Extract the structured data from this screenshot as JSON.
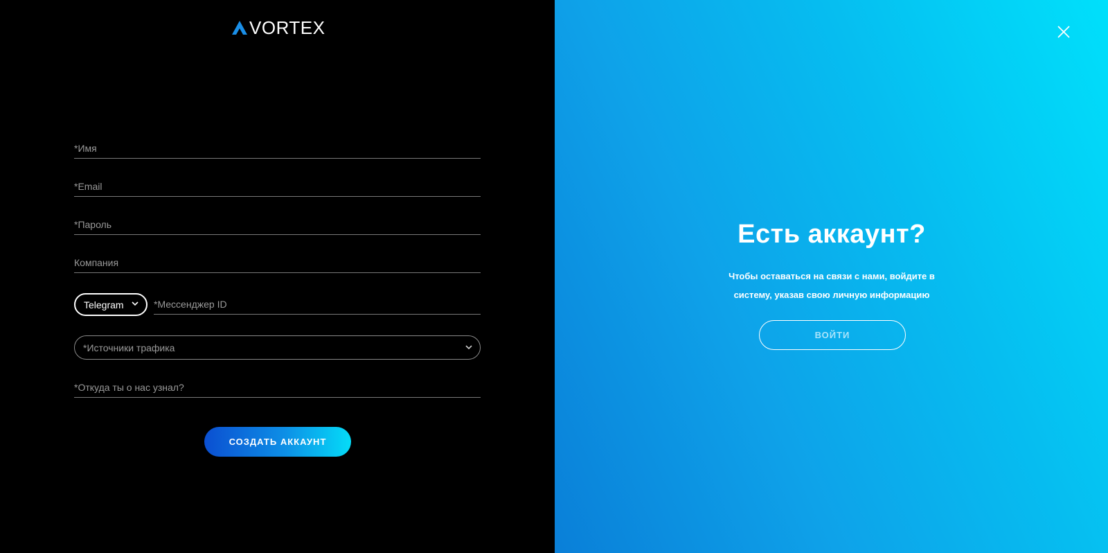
{
  "brand": {
    "name": "VORTEX",
    "accent": "#1a8fe8"
  },
  "form": {
    "name_placeholder": "*Имя",
    "email_placeholder": "*Email",
    "password_placeholder": "*Пароль",
    "company_placeholder": "Компания",
    "messenger_selected": "Telegram",
    "messenger_id_placeholder": "*Мессенджер ID",
    "traffic_sources_placeholder": "*Источники трафика",
    "referral_placeholder": "*Откуда ты о нас узнал?",
    "submit_label": "СОЗДАТЬ АККАУНТ"
  },
  "promo": {
    "title": "Есть аккаунт?",
    "text": "Чтобы оставаться на связи с нами, войдите в систему, указав свою личную информацию",
    "login_label": "ВОЙТИ"
  },
  "icons": {
    "close": "close-icon",
    "chevron": "chevron-down-icon",
    "logo": "triangle-logo-icon"
  }
}
